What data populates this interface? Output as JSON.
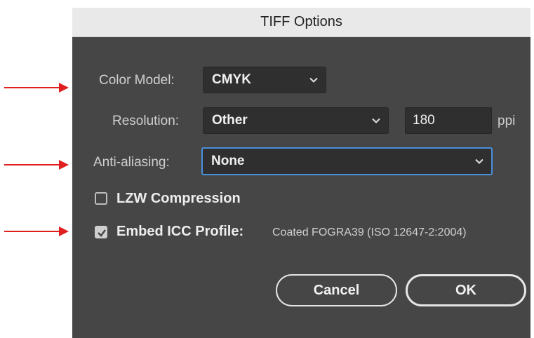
{
  "dialog": {
    "title": "TIFF Options",
    "color_model": {
      "label": "Color Model:",
      "value": "CMYK"
    },
    "resolution": {
      "label": "Resolution:",
      "value": "Other",
      "number": "180",
      "unit": "ppi"
    },
    "anti_aliasing": {
      "label": "Anti-aliasing:",
      "value": "None"
    },
    "lzw": {
      "label": "LZW Compression",
      "checked": false
    },
    "icc": {
      "label": "Embed ICC Profile:",
      "profile": "Coated FOGRA39 (ISO 12647-2:2004)",
      "checked": true
    },
    "buttons": {
      "cancel": "Cancel",
      "ok": "OK"
    }
  },
  "annotations": {
    "arrow_color": "#e02020",
    "arrow_count": 3
  },
  "colors": {
    "dialog_bg": "#464646",
    "titlebar_bg": "#e9e9e9",
    "focus_ring": "#4a8fd9"
  }
}
